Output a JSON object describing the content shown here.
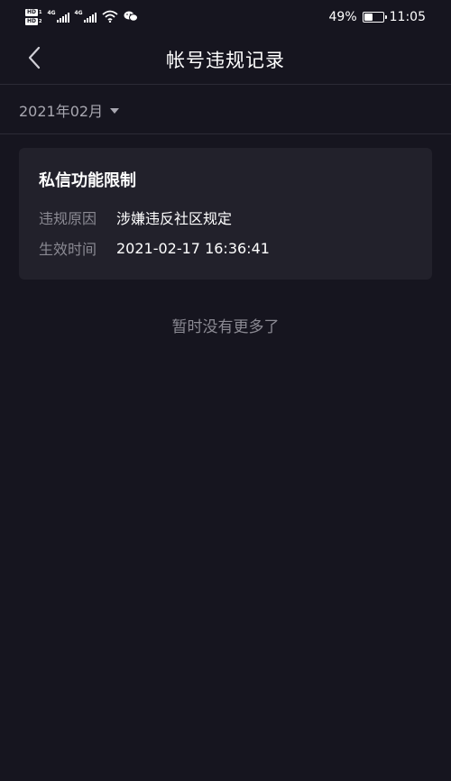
{
  "status_bar": {
    "sim1_badge": "HD",
    "sim1_num": "1",
    "sim2_badge": "HD",
    "sim2_num": "2",
    "net1": "4G",
    "net2": "4G",
    "battery_percent": "49%",
    "battery_level": 0.49,
    "time": "11:05"
  },
  "nav": {
    "title": "帐号违规记录",
    "back_icon": "chevron-left-icon"
  },
  "filter": {
    "month": "2021年02月",
    "icon": "caret-down-icon"
  },
  "records": [
    {
      "title": "私信功能限制",
      "rows": [
        {
          "key": "违规原因",
          "value": "涉嫌违反社区规定"
        },
        {
          "key": "生效时间",
          "value": "2021-02-17 16:36:41"
        }
      ]
    }
  ],
  "footer_text": "暂时没有更多了",
  "colors": {
    "background": "#16151f",
    "card": "#22212b",
    "muted_text": "#8b8a93"
  }
}
